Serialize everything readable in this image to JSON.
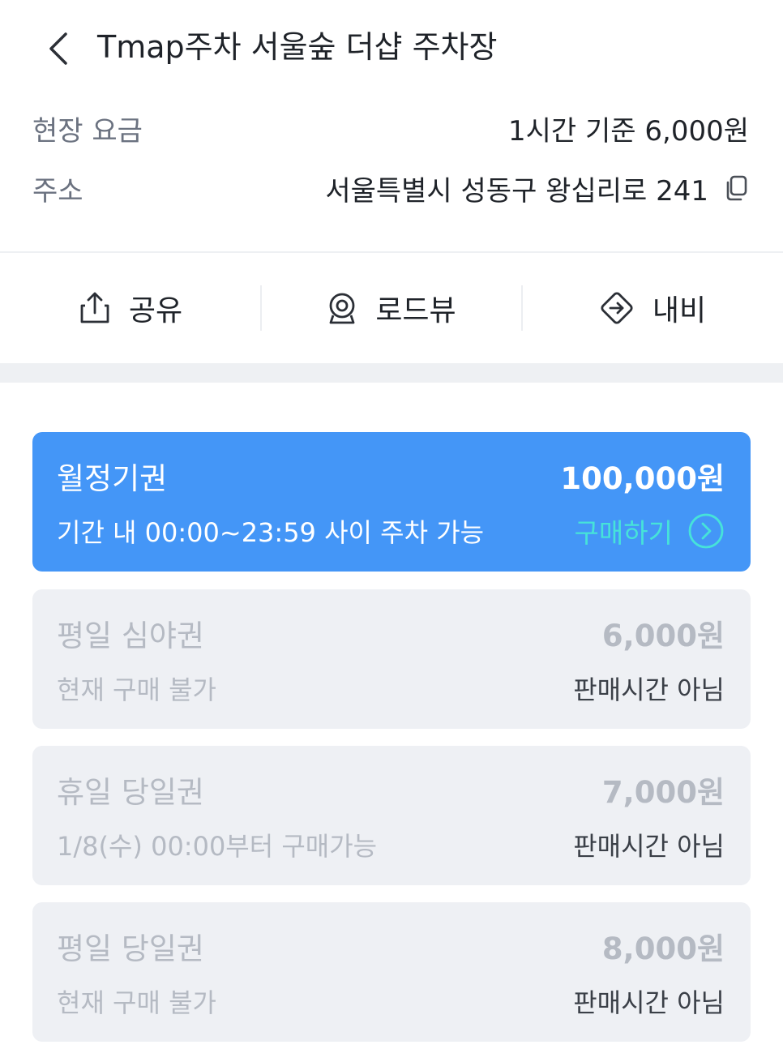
{
  "header": {
    "title": "Tmap주차 서울숲 더샵 주차장"
  },
  "info": {
    "fee_label": "현장 요금",
    "fee_value": "1시간 기준 6,000원",
    "address_label": "주소",
    "address_value": "서울특별시 성동구 왕십리로 241"
  },
  "actions": [
    {
      "label": "공유",
      "icon": "share-icon"
    },
    {
      "label": "로드뷰",
      "icon": "roadview-icon"
    },
    {
      "label": "내비",
      "icon": "navigation-icon"
    }
  ],
  "tickets": [
    {
      "name": "월정기권",
      "price": "100,000원",
      "desc": "기간 내 00:00~23:59 사이 주차 가능",
      "action": "구매하기",
      "active": true
    },
    {
      "name": "평일 심야권",
      "price": "6,000원",
      "desc": "현재 구매 불가",
      "status": "판매시간 아님",
      "active": false
    },
    {
      "name": "휴일 당일권",
      "price": "7,000원",
      "desc": "1/8(수) 00:00부터 구매가능",
      "status": "판매시간 아님",
      "active": false
    },
    {
      "name": "평일 당일권",
      "price": "8,000원",
      "desc": "현재 구매 불가",
      "status": "판매시간 아님",
      "active": false
    }
  ],
  "colors": {
    "accent": "#4496f7",
    "buy_link": "#46e3d9",
    "disabled_card": "#eef0f4",
    "disabled_text": "#b5bac3"
  }
}
